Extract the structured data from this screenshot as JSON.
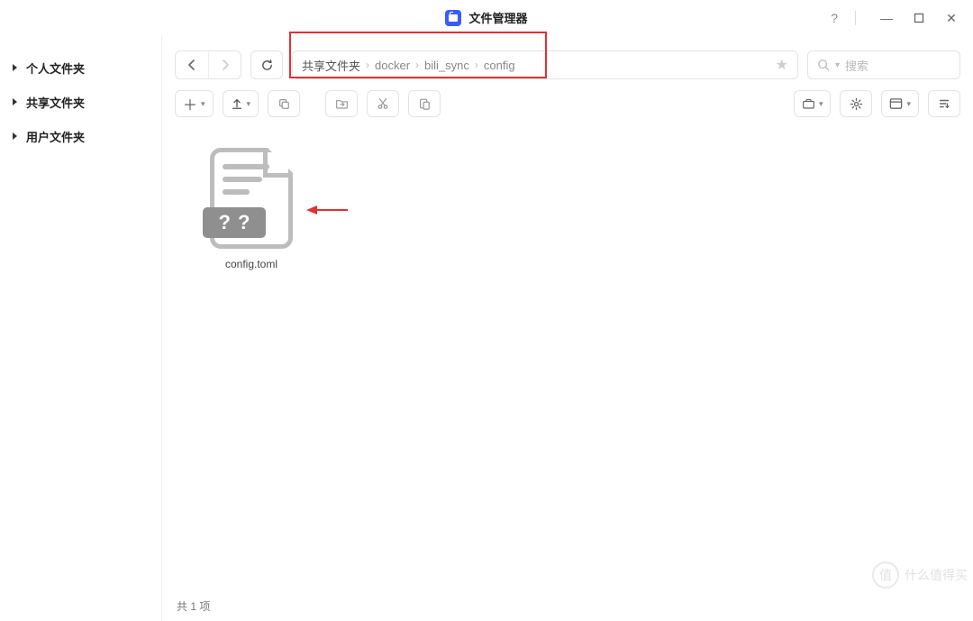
{
  "app": {
    "title": "文件管理器"
  },
  "window": {
    "help": "?",
    "min": "—",
    "max": "□",
    "close": "✕"
  },
  "sidebar": {
    "items": [
      {
        "label": "个人文件夹"
      },
      {
        "label": "共享文件夹"
      },
      {
        "label": "用户文件夹"
      }
    ]
  },
  "breadcrumb": {
    "items": [
      "共享文件夹",
      "docker",
      "bili_sync",
      "config"
    ]
  },
  "search": {
    "placeholder": "搜索"
  },
  "toolbar": {
    "add": "＋",
    "upload": "↥"
  },
  "files": [
    {
      "name": "config.toml",
      "badge": "? ?"
    }
  ],
  "status": {
    "text": "共 1 项"
  },
  "watermark": {
    "char": "值",
    "text": "什么值得买"
  }
}
